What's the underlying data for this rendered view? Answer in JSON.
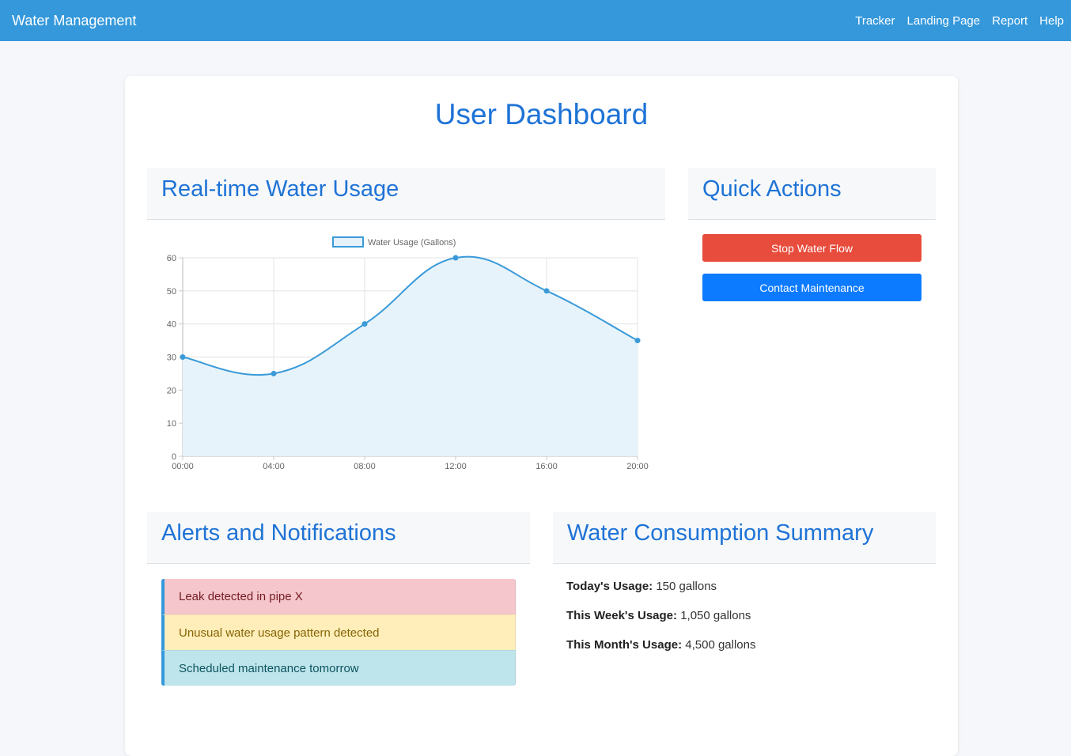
{
  "navbar": {
    "brand": "Water Management",
    "links": [
      "Tracker",
      "Landing Page",
      "Report",
      "Help"
    ]
  },
  "page": {
    "title": "User Dashboard"
  },
  "usage_card": {
    "title": "Real-time Water Usage"
  },
  "actions_card": {
    "title": "Quick Actions",
    "stop_label": "Stop Water Flow",
    "contact_label": "Contact Maintenance"
  },
  "alerts_card": {
    "title": "Alerts and Notifications",
    "items": [
      {
        "text": "Leak detected in pipe X",
        "level": "danger"
      },
      {
        "text": "Unusual water usage pattern detected",
        "level": "warning"
      },
      {
        "text": "Scheduled maintenance tomorrow",
        "level": "info"
      }
    ]
  },
  "summary_card": {
    "title": "Water Consumption Summary",
    "rows": [
      {
        "label": "Today's Usage:",
        "value": "150 gallons"
      },
      {
        "label": "This Week's Usage:",
        "value": "1,050 gallons"
      },
      {
        "label": "This Month's Usage:",
        "value": "4,500 gallons"
      }
    ]
  },
  "colors": {
    "navbar": "#3498db",
    "title": "#1e73d6",
    "danger": "#e74c3c",
    "primary": "#0d7bff",
    "series_line": "#3a9ad9",
    "series_fill": "#e6f2fa"
  },
  "chart_data": {
    "type": "line",
    "title": "",
    "xlabel": "",
    "ylabel": "",
    "categories": [
      "00:00",
      "04:00",
      "08:00",
      "12:00",
      "16:00",
      "20:00"
    ],
    "series": [
      {
        "name": "Water Usage (Gallons)",
        "values": [
          30,
          25,
          40,
          60,
          50,
          35
        ],
        "fill": true
      }
    ],
    "ylim": [
      0,
      60
    ],
    "yticks": [
      0,
      10,
      20,
      30,
      40,
      50,
      60
    ],
    "grid": true,
    "legend": "top-center",
    "smooth": true
  }
}
